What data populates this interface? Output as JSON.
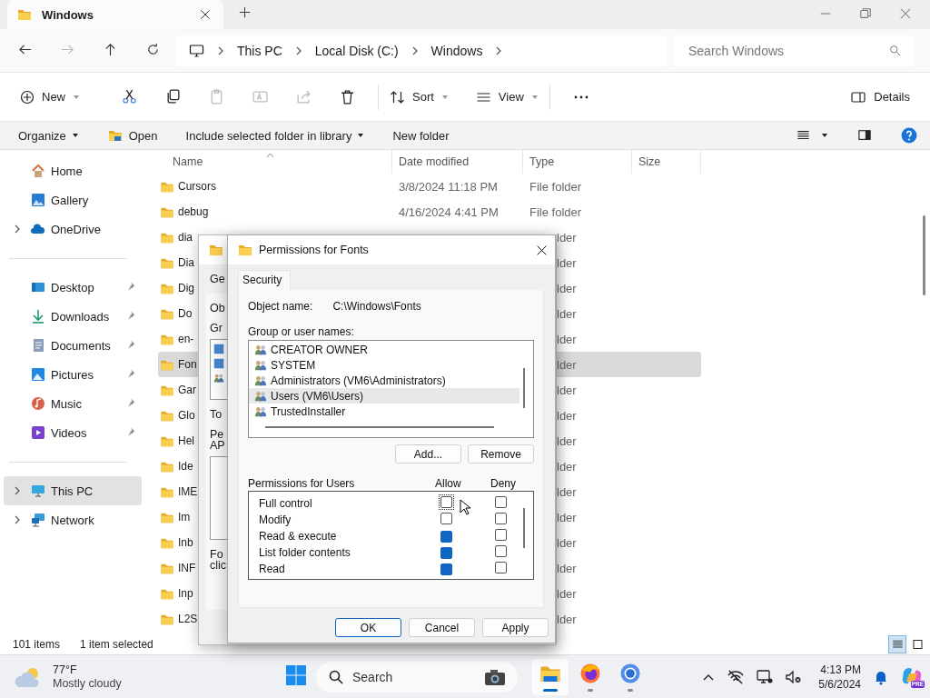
{
  "window": {
    "tab_title": "Windows"
  },
  "address": {
    "crumbs": [
      "This PC",
      "Local Disk (C:)",
      "Windows"
    ],
    "search_placeholder": "Search Windows"
  },
  "commands": [
    {
      "kind": "new",
      "label": "New",
      "disabled": false
    },
    {
      "kind": "cut",
      "disabled": false
    },
    {
      "kind": "copy",
      "disabled": false
    },
    {
      "kind": "paste",
      "disabled": true
    },
    {
      "kind": "rename",
      "disabled": true
    },
    {
      "kind": "share",
      "disabled": true
    },
    {
      "kind": "delete",
      "disabled": false
    },
    {
      "kind": "sort",
      "label": "Sort",
      "disabled": false
    },
    {
      "kind": "view",
      "label": "View",
      "disabled": false
    },
    {
      "kind": "more",
      "disabled": false
    },
    {
      "kind": "details",
      "label": "Details",
      "disabled": false
    }
  ],
  "legacy_bar": [
    {
      "kind": "menu",
      "label": "Organize"
    },
    {
      "kind": "open",
      "label": "Open"
    },
    {
      "kind": "menu",
      "label": "Include selected folder in library"
    },
    {
      "kind": "plain",
      "label": "New folder"
    }
  ],
  "sidebar": {
    "groups": [
      {
        "items": [
          {
            "kind": "home",
            "label": "Home",
            "expandable": false,
            "pinned": false,
            "selected": false
          },
          {
            "kind": "gallery",
            "label": "Gallery",
            "expandable": false,
            "pinned": false,
            "selected": false
          },
          {
            "kind": "cloud",
            "label": "OneDrive",
            "expandable": true,
            "pinned": false,
            "selected": false
          }
        ]
      },
      {
        "items": [
          {
            "kind": "desktop",
            "label": "Desktop",
            "expandable": false,
            "pinned": true,
            "selected": false
          },
          {
            "kind": "downloads",
            "label": "Downloads",
            "expandable": false,
            "pinned": true,
            "selected": false
          },
          {
            "kind": "documents",
            "label": "Documents",
            "expandable": false,
            "pinned": true,
            "selected": false
          },
          {
            "kind": "pictures",
            "label": "Pictures",
            "expandable": false,
            "pinned": true,
            "selected": false
          },
          {
            "kind": "music",
            "label": "Music",
            "expandable": false,
            "pinned": true,
            "selected": false
          },
          {
            "kind": "videos",
            "label": "Videos",
            "expandable": false,
            "pinned": true,
            "selected": false
          }
        ]
      },
      {
        "items": [
          {
            "kind": "pc",
            "label": "This PC",
            "expandable": true,
            "pinned": false,
            "selected": true
          },
          {
            "kind": "network",
            "label": "Network",
            "expandable": true,
            "pinned": false,
            "selected": false
          }
        ]
      }
    ]
  },
  "files": {
    "columns": [
      "Name",
      "Date modified",
      "Type",
      "Size"
    ],
    "rows": [
      {
        "kind": "full",
        "name": "Cursors",
        "date": "3/8/2024 11:18 PM",
        "type": "File folder",
        "selected": false
      },
      {
        "kind": "full",
        "name": "debug",
        "date": "4/16/2024 4:41 PM",
        "type": "File folder",
        "selected": false
      },
      {
        "kind": "partial",
        "name": "dia",
        "type": "lder",
        "selected": false
      },
      {
        "kind": "partial",
        "name": "Dia",
        "type": "lder",
        "selected": false
      },
      {
        "kind": "partial",
        "name": "Dig",
        "type": "lder",
        "selected": false
      },
      {
        "kind": "partial",
        "name": "Do",
        "type": "lder",
        "selected": false
      },
      {
        "kind": "partial",
        "name": "en-",
        "type": "lder",
        "selected": false
      },
      {
        "kind": "partial",
        "name": "Fon",
        "type": "lder",
        "selected": true
      },
      {
        "kind": "partial",
        "name": "Gar",
        "type": "lder",
        "selected": false
      },
      {
        "kind": "partial",
        "name": "Glo",
        "type": "lder",
        "selected": false
      },
      {
        "kind": "partial",
        "name": "Hel",
        "type": "lder",
        "selected": false
      },
      {
        "kind": "partial",
        "name": "Ide",
        "type": "lder",
        "selected": false
      },
      {
        "kind": "partial",
        "name": "IME",
        "type": "lder",
        "selected": false
      },
      {
        "kind": "partial",
        "name": "Im",
        "type": "lder",
        "selected": false
      },
      {
        "kind": "partial",
        "name": "Inb",
        "type": "lder",
        "selected": false
      },
      {
        "kind": "partial",
        "name": "INF",
        "type": "lder",
        "selected": false
      },
      {
        "kind": "partial",
        "name": "Inp",
        "type": "lder",
        "selected": false
      },
      {
        "kind": "partial",
        "name": "L2S",
        "type": "lder",
        "selected": false
      }
    ]
  },
  "status_bar": {
    "count": "101 items",
    "selection": "1 item selected",
    "views": [
      {
        "kind": "details",
        "selected": true
      },
      {
        "kind": "tiles",
        "selected": false
      }
    ]
  },
  "back_dialog": {
    "items": [
      {
        "kind": "tab",
        "text": "Ge"
      },
      {
        "kind": "text",
        "text": "Ob"
      },
      {
        "kind": "text",
        "text": "Gr"
      },
      {
        "kind": "listbox"
      },
      {
        "kind": "text",
        "text": "To"
      },
      {
        "kind": "text",
        "text": "Pe"
      },
      {
        "kind": "tight",
        "text": "AP"
      },
      {
        "kind": "box"
      },
      {
        "kind": "text",
        "text": "Fo"
      },
      {
        "kind": "tight",
        "text": "clic"
      }
    ]
  },
  "dialog": {
    "title": "Permissions for Fonts",
    "tabs": [
      {
        "label": "Security",
        "selected": true
      }
    ],
    "object_label": "Object name:",
    "object_value": "C:\\Windows\\Fonts",
    "groups_label": "Group or user names:",
    "groups": [
      {
        "name": "CREATOR OWNER",
        "selected": false
      },
      {
        "name": "SYSTEM",
        "selected": false
      },
      {
        "name": "Administrators (VM6\\Administrators)",
        "selected": false
      },
      {
        "name": "Users (VM6\\Users)",
        "selected": true
      },
      {
        "name": "TrustedInstaller",
        "selected": false
      }
    ],
    "group_buttons": [
      "Add...",
      "Remove"
    ],
    "permissions_label": "Permissions for Users",
    "allow_label": "Allow",
    "deny_label": "Deny",
    "permissions": [
      {
        "name": "Full control",
        "allow": false,
        "deny": false,
        "focused": true
      },
      {
        "name": "Modify",
        "allow": false,
        "deny": false,
        "focused": false
      },
      {
        "name": "Read & execute",
        "allow": true,
        "deny": false,
        "focused": false
      },
      {
        "name": "List folder contents",
        "allow": true,
        "deny": false,
        "focused": false
      },
      {
        "name": "Read",
        "allow": true,
        "deny": false,
        "focused": false
      }
    ],
    "buttons": [
      {
        "label": "OK",
        "default": true
      },
      {
        "label": "Cancel",
        "default": false
      },
      {
        "label": "Apply",
        "default": false
      }
    ]
  },
  "taskbar": {
    "temperature": "77°F",
    "weather": "Mostly cloudy",
    "search": "Search",
    "apps": [
      {
        "kind": "explorer",
        "active": true,
        "running": true
      },
      {
        "kind": "firefox",
        "active": false,
        "running": true
      },
      {
        "kind": "browser",
        "active": false,
        "running": true
      }
    ],
    "time": "4:13 PM",
    "date": "5/6/2024",
    "badge": "PRE"
  }
}
